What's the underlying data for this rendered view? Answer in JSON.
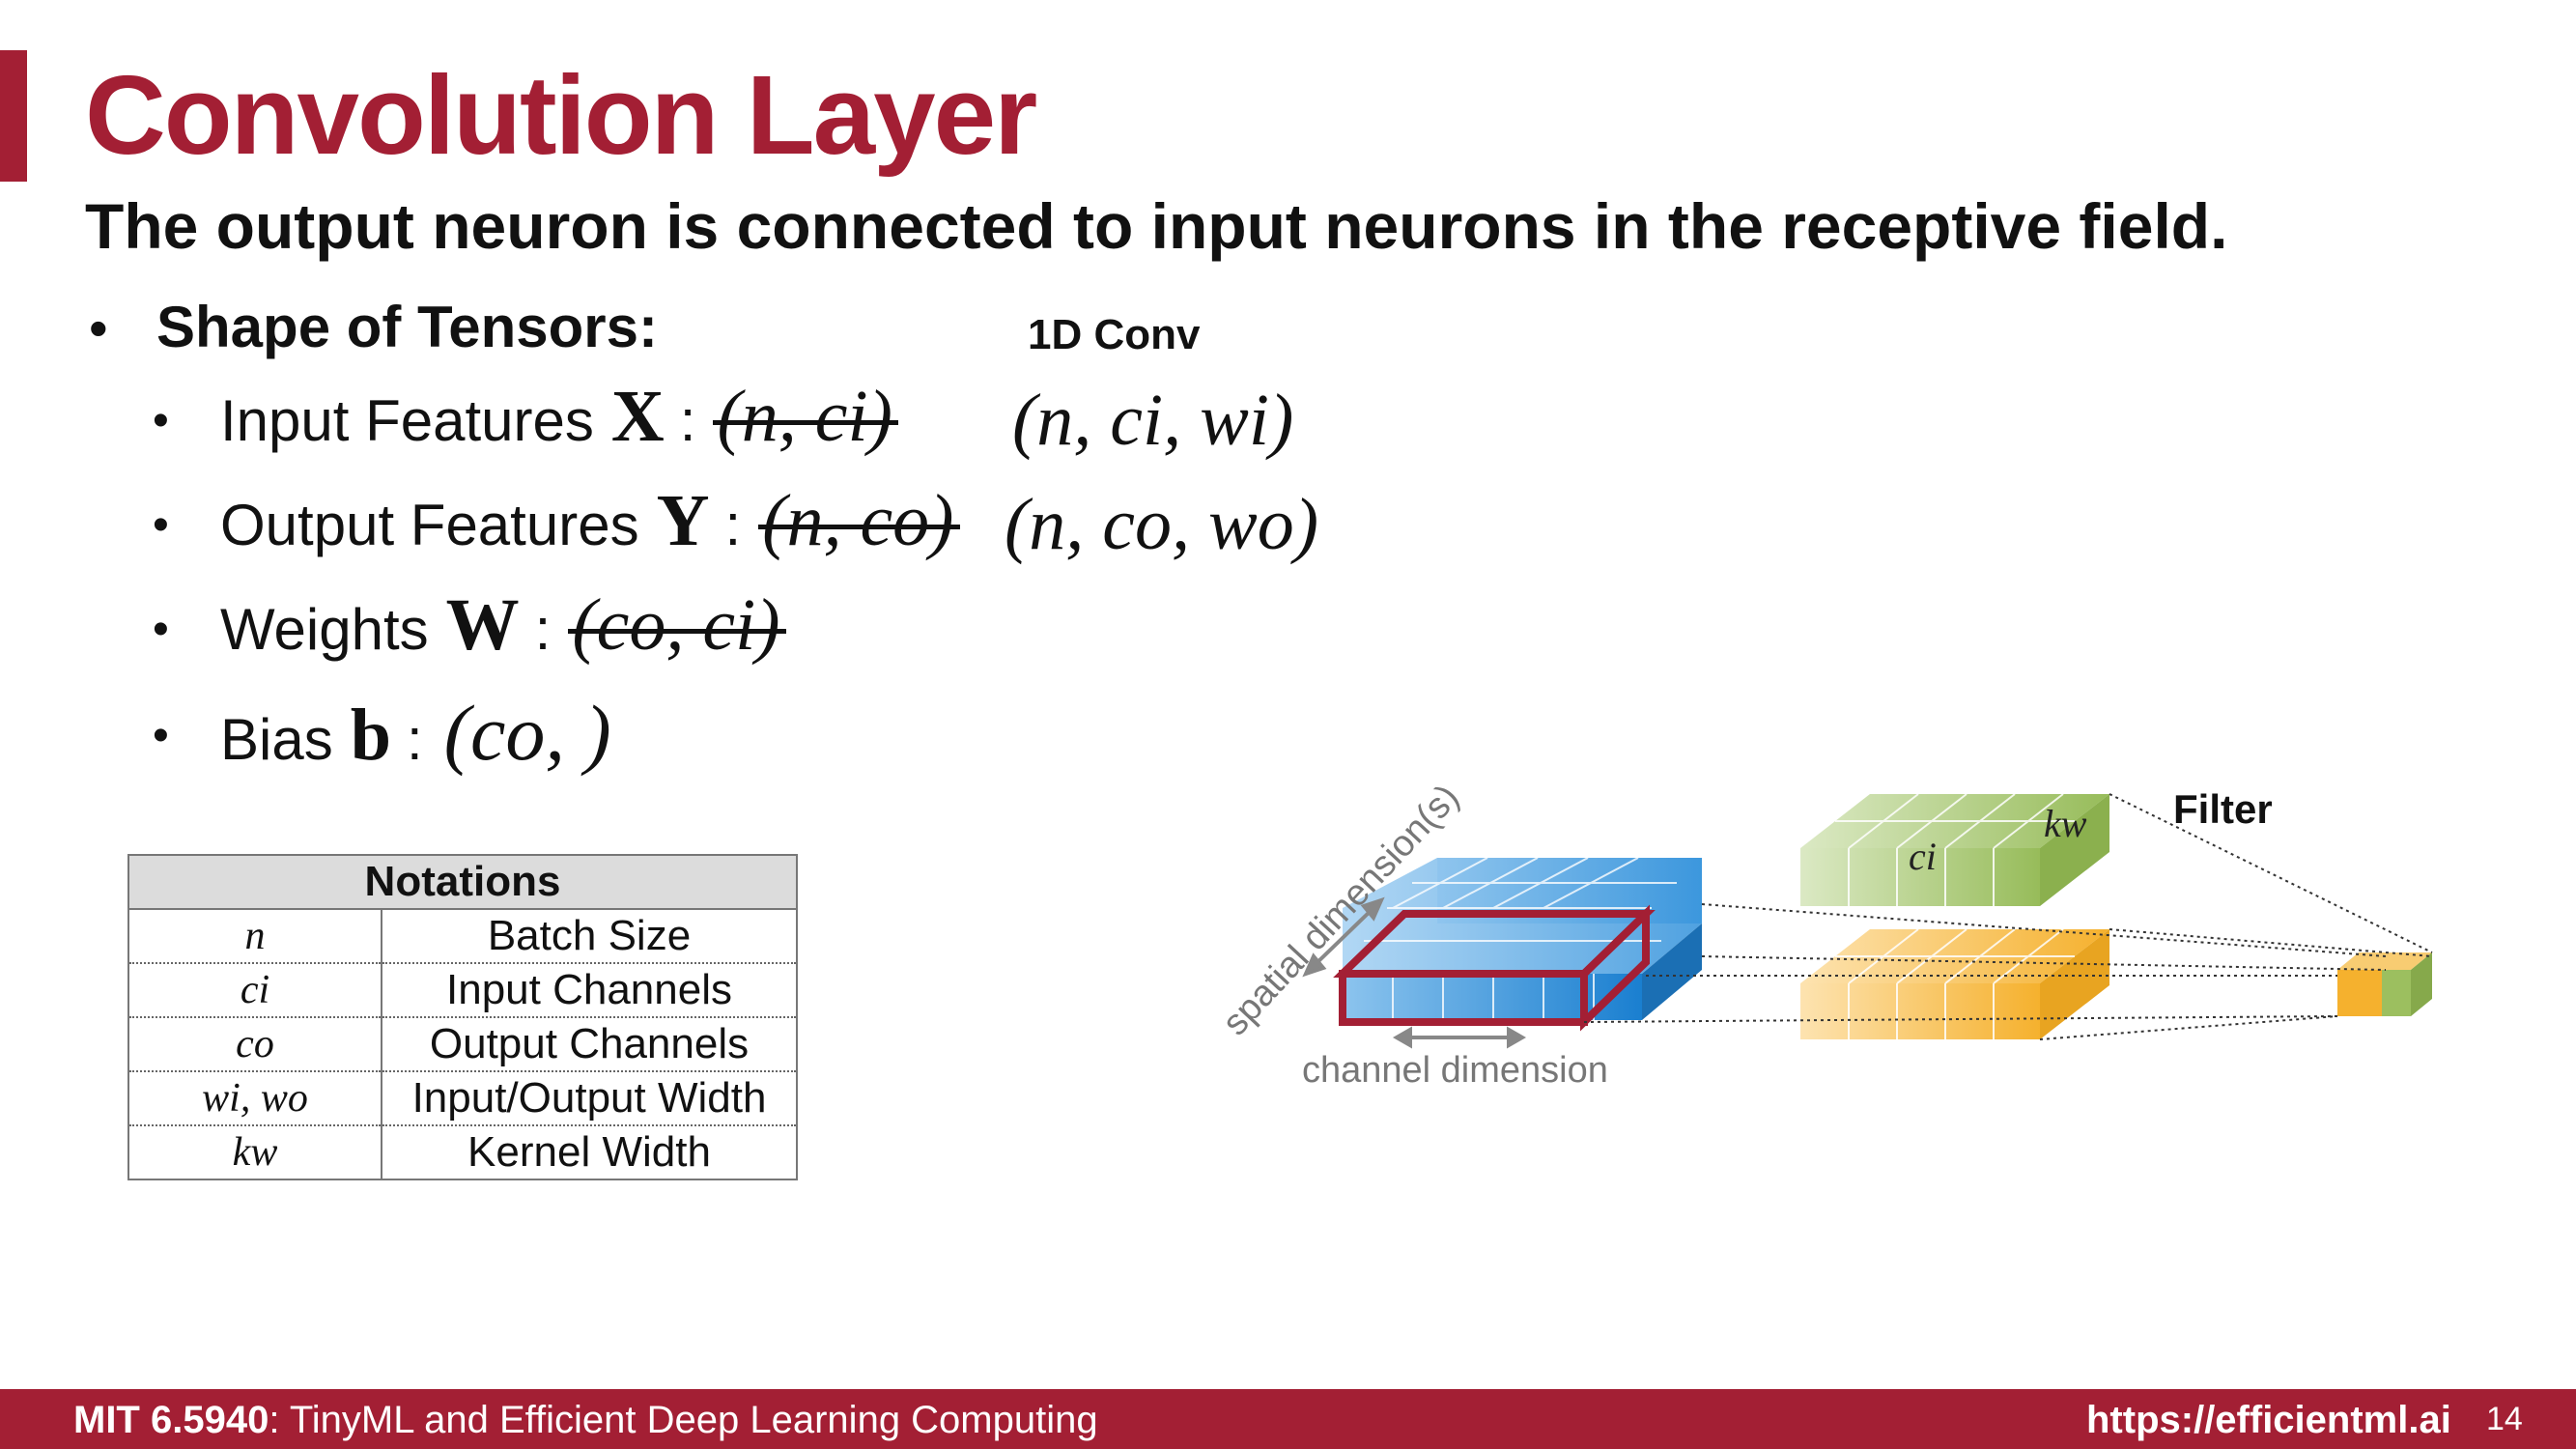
{
  "slide": {
    "title": "Convolution Layer",
    "subtitle": "The output neuron is connected to input neurons in the receptive field.",
    "section_label": "Shape of Tensors:",
    "conv_label": "1D Conv"
  },
  "tensors": [
    {
      "name": "Input Features",
      "symbol": "X",
      "old_shape": "(n, ci)",
      "new_shape": "(n, ci, wi)"
    },
    {
      "name": "Output Features",
      "symbol": "Y",
      "old_shape": "(n, co)",
      "new_shape": "(n, co, wo)"
    },
    {
      "name": "Weights",
      "symbol": "W",
      "old_shape": "(co, ci)",
      "new_shape": ""
    },
    {
      "name": "Bias",
      "symbol": "b",
      "old_shape": "",
      "new_shape": "(co, )"
    }
  ],
  "notations": {
    "header": "Notations",
    "rows": [
      {
        "symbol": "n",
        "meaning": "Batch Size"
      },
      {
        "symbol": "ci",
        "meaning": "Input Channels"
      },
      {
        "symbol": "co",
        "meaning": "Output Channels"
      },
      {
        "symbol": "wi, wo",
        "meaning": "Input/Output Width"
      },
      {
        "symbol": "kw",
        "meaning": "Kernel Width"
      }
    ]
  },
  "diagram": {
    "filter_label": "Filter",
    "spatial_label": "spatial dimension(s)",
    "channel_label": "channel dimension",
    "ci_label": "ci",
    "kw_label": "kw",
    "colors": {
      "input": "#2f8fd8",
      "highlight": "#a31f34",
      "filter_green": "#9cbf5f",
      "filter_yellow": "#f6b93b",
      "output": "#f6b93b"
    }
  },
  "footer": {
    "course_code": "MIT 6.5940",
    "course_name": ": TinyML and Efficient Deep Learning Computing",
    "url": "https://efficientml.ai",
    "page_number": "14"
  }
}
